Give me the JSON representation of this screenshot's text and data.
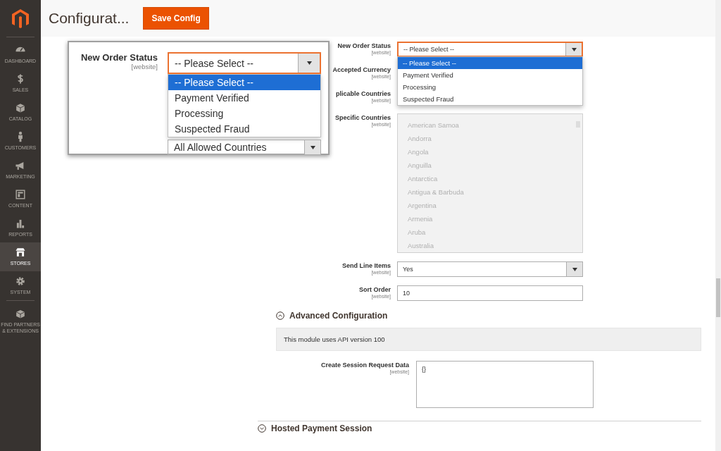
{
  "sidebar": {
    "items": [
      {
        "label": "DASHBOARD",
        "selected": false
      },
      {
        "label": "SALES",
        "selected": false
      },
      {
        "label": "CATALOG",
        "selected": false
      },
      {
        "label": "CUSTOMERS",
        "selected": false
      },
      {
        "label": "MARKETING",
        "selected": false
      },
      {
        "label": "CONTENT",
        "selected": false
      },
      {
        "label": "REPORTS",
        "selected": false
      },
      {
        "label": "STORES",
        "selected": true
      },
      {
        "label": "SYSTEM",
        "selected": false
      },
      {
        "label": "FIND PARTNERS & EXTENSIONS",
        "selected": false
      }
    ]
  },
  "header": {
    "title": "Configurat...",
    "save_button": "Save Config"
  },
  "form": {
    "fields": [
      {
        "kind": "select",
        "label": "New Order Status",
        "scope": "[website]",
        "value": "-- Please Select --",
        "open": true,
        "options": [
          {
            "label": "-- Please Select --",
            "selected": true
          },
          {
            "label": "Payment Verified",
            "selected": false
          },
          {
            "label": "Processing",
            "selected": false
          },
          {
            "label": "Suspected Fraud",
            "selected": false
          }
        ]
      },
      {
        "kind": "label",
        "label": "Accepted Currency",
        "scope": "[website]"
      },
      {
        "kind": "label",
        "label": "plicable Countries",
        "scope": "[website]"
      },
      {
        "kind": "multiselect",
        "label": "Specific Countries",
        "scope": "[website]",
        "disabled": true,
        "options": [
          "American Samoa",
          "Andorra",
          "Angola",
          "Anguilla",
          "Antarctica",
          "Antigua & Barbuda",
          "Argentina",
          "Armenia",
          "Aruba",
          "Australia"
        ]
      },
      {
        "kind": "select",
        "label": "Send Line Items",
        "scope": "[website]",
        "value": "Yes",
        "open": false
      },
      {
        "kind": "text",
        "label": "Sort Order",
        "scope": "[website]",
        "value": "10"
      }
    ]
  },
  "advanced": {
    "title": "Advanced Configuration",
    "expanded": true,
    "note": "This module uses API version 100",
    "fields": [
      {
        "kind": "textarea",
        "label": "Create Session Request Data",
        "scope": "[website]",
        "value": "{}"
      }
    ]
  },
  "next_section": {
    "title": "Hosted Payment Session",
    "expanded": false
  },
  "magnifier": {
    "label": "New Order Status",
    "scope": "[website]",
    "value": "-- Please Select --",
    "options": [
      {
        "label": "-- Please Select --",
        "selected": true
      },
      {
        "label": "Payment Verified",
        "selected": false
      },
      {
        "label": "Processing",
        "selected": false
      },
      {
        "label": "Suspected Fraud",
        "selected": false
      }
    ],
    "below_value": "All Allowed Countries"
  }
}
